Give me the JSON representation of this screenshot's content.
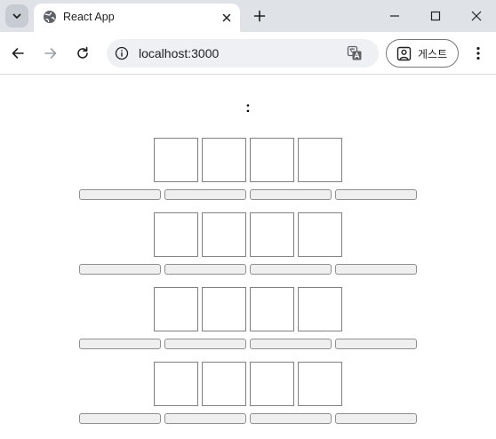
{
  "browser": {
    "tab": {
      "title": "React App",
      "favicon": "globe-icon"
    },
    "address": {
      "url": "localhost:3000"
    },
    "profile": {
      "label": "게스트"
    },
    "icons": {
      "tab_search": "chevron-down-icon",
      "tab_close": "close-icon",
      "new_tab": "plus-icon",
      "minimize": "minimize-icon",
      "maximize": "maximize-icon",
      "window_close": "close-icon",
      "back": "back-arrow-icon",
      "forward": "forward-arrow-icon",
      "reload": "reload-icon",
      "site_info": "info-icon",
      "translate": "translate-icon",
      "profile": "person-icon",
      "menu": "more-vertical-icon"
    },
    "colors": {
      "tabstrip": "#dfe3e8",
      "omnibox": "#eef0f3",
      "cell_border": "#808080",
      "button_bg": "#efefef"
    }
  },
  "app": {
    "heading": ":",
    "rows": [
      {
        "cells": [
          "",
          "",
          "",
          ""
        ],
        "buttons": [
          "",
          "",
          "",
          ""
        ]
      },
      {
        "cells": [
          "",
          "",
          "",
          ""
        ],
        "buttons": [
          "",
          "",
          "",
          ""
        ]
      },
      {
        "cells": [
          "",
          "",
          "",
          ""
        ],
        "buttons": [
          "",
          "",
          "",
          ""
        ]
      },
      {
        "cells": [
          "",
          "",
          "",
          ""
        ],
        "buttons": [
          "",
          "",
          "",
          ""
        ]
      }
    ]
  }
}
